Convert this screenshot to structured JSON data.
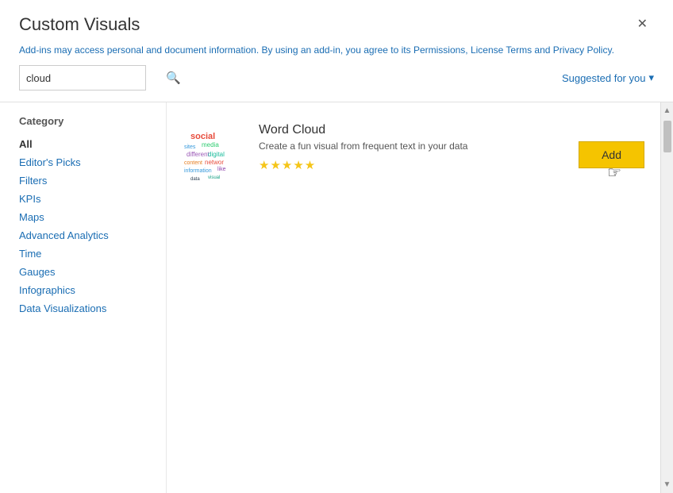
{
  "dialog": {
    "title": "Custom Visuals",
    "close_label": "✕"
  },
  "notice": {
    "text": "Add-ins may access personal and document information. By using an add-in, you agree to its Permissions, License Terms and Privacy Policy."
  },
  "search": {
    "value": "cloud",
    "placeholder": "Search"
  },
  "suggested": {
    "label": "Suggested for you",
    "chevron": "▾"
  },
  "category": {
    "label": "Category",
    "items": [
      {
        "id": "all",
        "label": "All",
        "active": true
      },
      {
        "id": "editors-picks",
        "label": "Editor's Picks",
        "active": false
      },
      {
        "id": "filters",
        "label": "Filters",
        "active": false
      },
      {
        "id": "kpis",
        "label": "KPIs",
        "active": false
      },
      {
        "id": "maps",
        "label": "Maps",
        "active": false
      },
      {
        "id": "advanced-analytics",
        "label": "Advanced Analytics",
        "active": false
      },
      {
        "id": "time",
        "label": "Time",
        "active": false
      },
      {
        "id": "gauges",
        "label": "Gauges",
        "active": false
      },
      {
        "id": "infographics",
        "label": "Infographics",
        "active": false
      },
      {
        "id": "data-visualizations",
        "label": "Data Visualizations",
        "active": false
      }
    ]
  },
  "results": [
    {
      "id": "word-cloud",
      "title": "Word Cloud",
      "description": "Create a fun visual from frequent text in your data",
      "stars": 5,
      "add_label": "Add"
    }
  ]
}
